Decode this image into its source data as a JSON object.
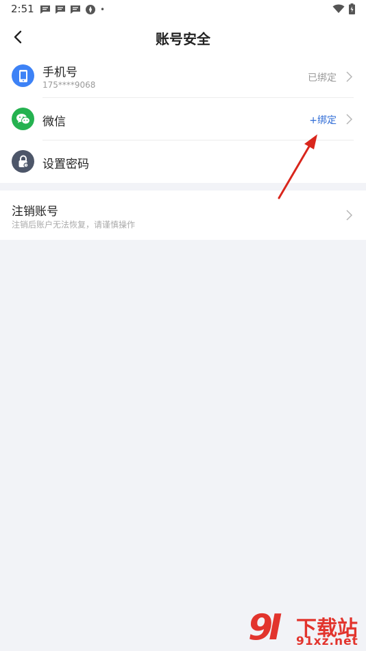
{
  "statusbar": {
    "time": "2:51",
    "dot": "•",
    "notifications": [
      "message-icon",
      "message-icon",
      "message-icon",
      "vpn-icon"
    ],
    "right_icons": [
      "wifi-icon",
      "battery-icon"
    ]
  },
  "header": {
    "title": "账号安全",
    "back_icon": "back-arrow-icon"
  },
  "account": {
    "phone": {
      "label": "手机号",
      "value": "175****9068",
      "status": "已绑定",
      "icon": "phone-icon",
      "icon_color": "#3d82f6"
    },
    "wechat": {
      "label": "微信",
      "status": "+绑定",
      "status_color": "#2e6bd6",
      "icon": "wechat-icon",
      "icon_color": "#25b250"
    },
    "password": {
      "label": "设置密码",
      "icon": "lock-icon",
      "icon_color": "#4d5669"
    }
  },
  "cancel_account": {
    "title": "注销账号",
    "subtitle": "注销后账户无法恢复，请谨慎操作"
  },
  "watermark": {
    "logo_text": "9I",
    "cn_text": "下载站",
    "url_text": "91xz.net"
  },
  "colors": {
    "accent": "#2e6bd6",
    "annotation_arrow": "#d9261c",
    "background": "#f2f3f7"
  }
}
